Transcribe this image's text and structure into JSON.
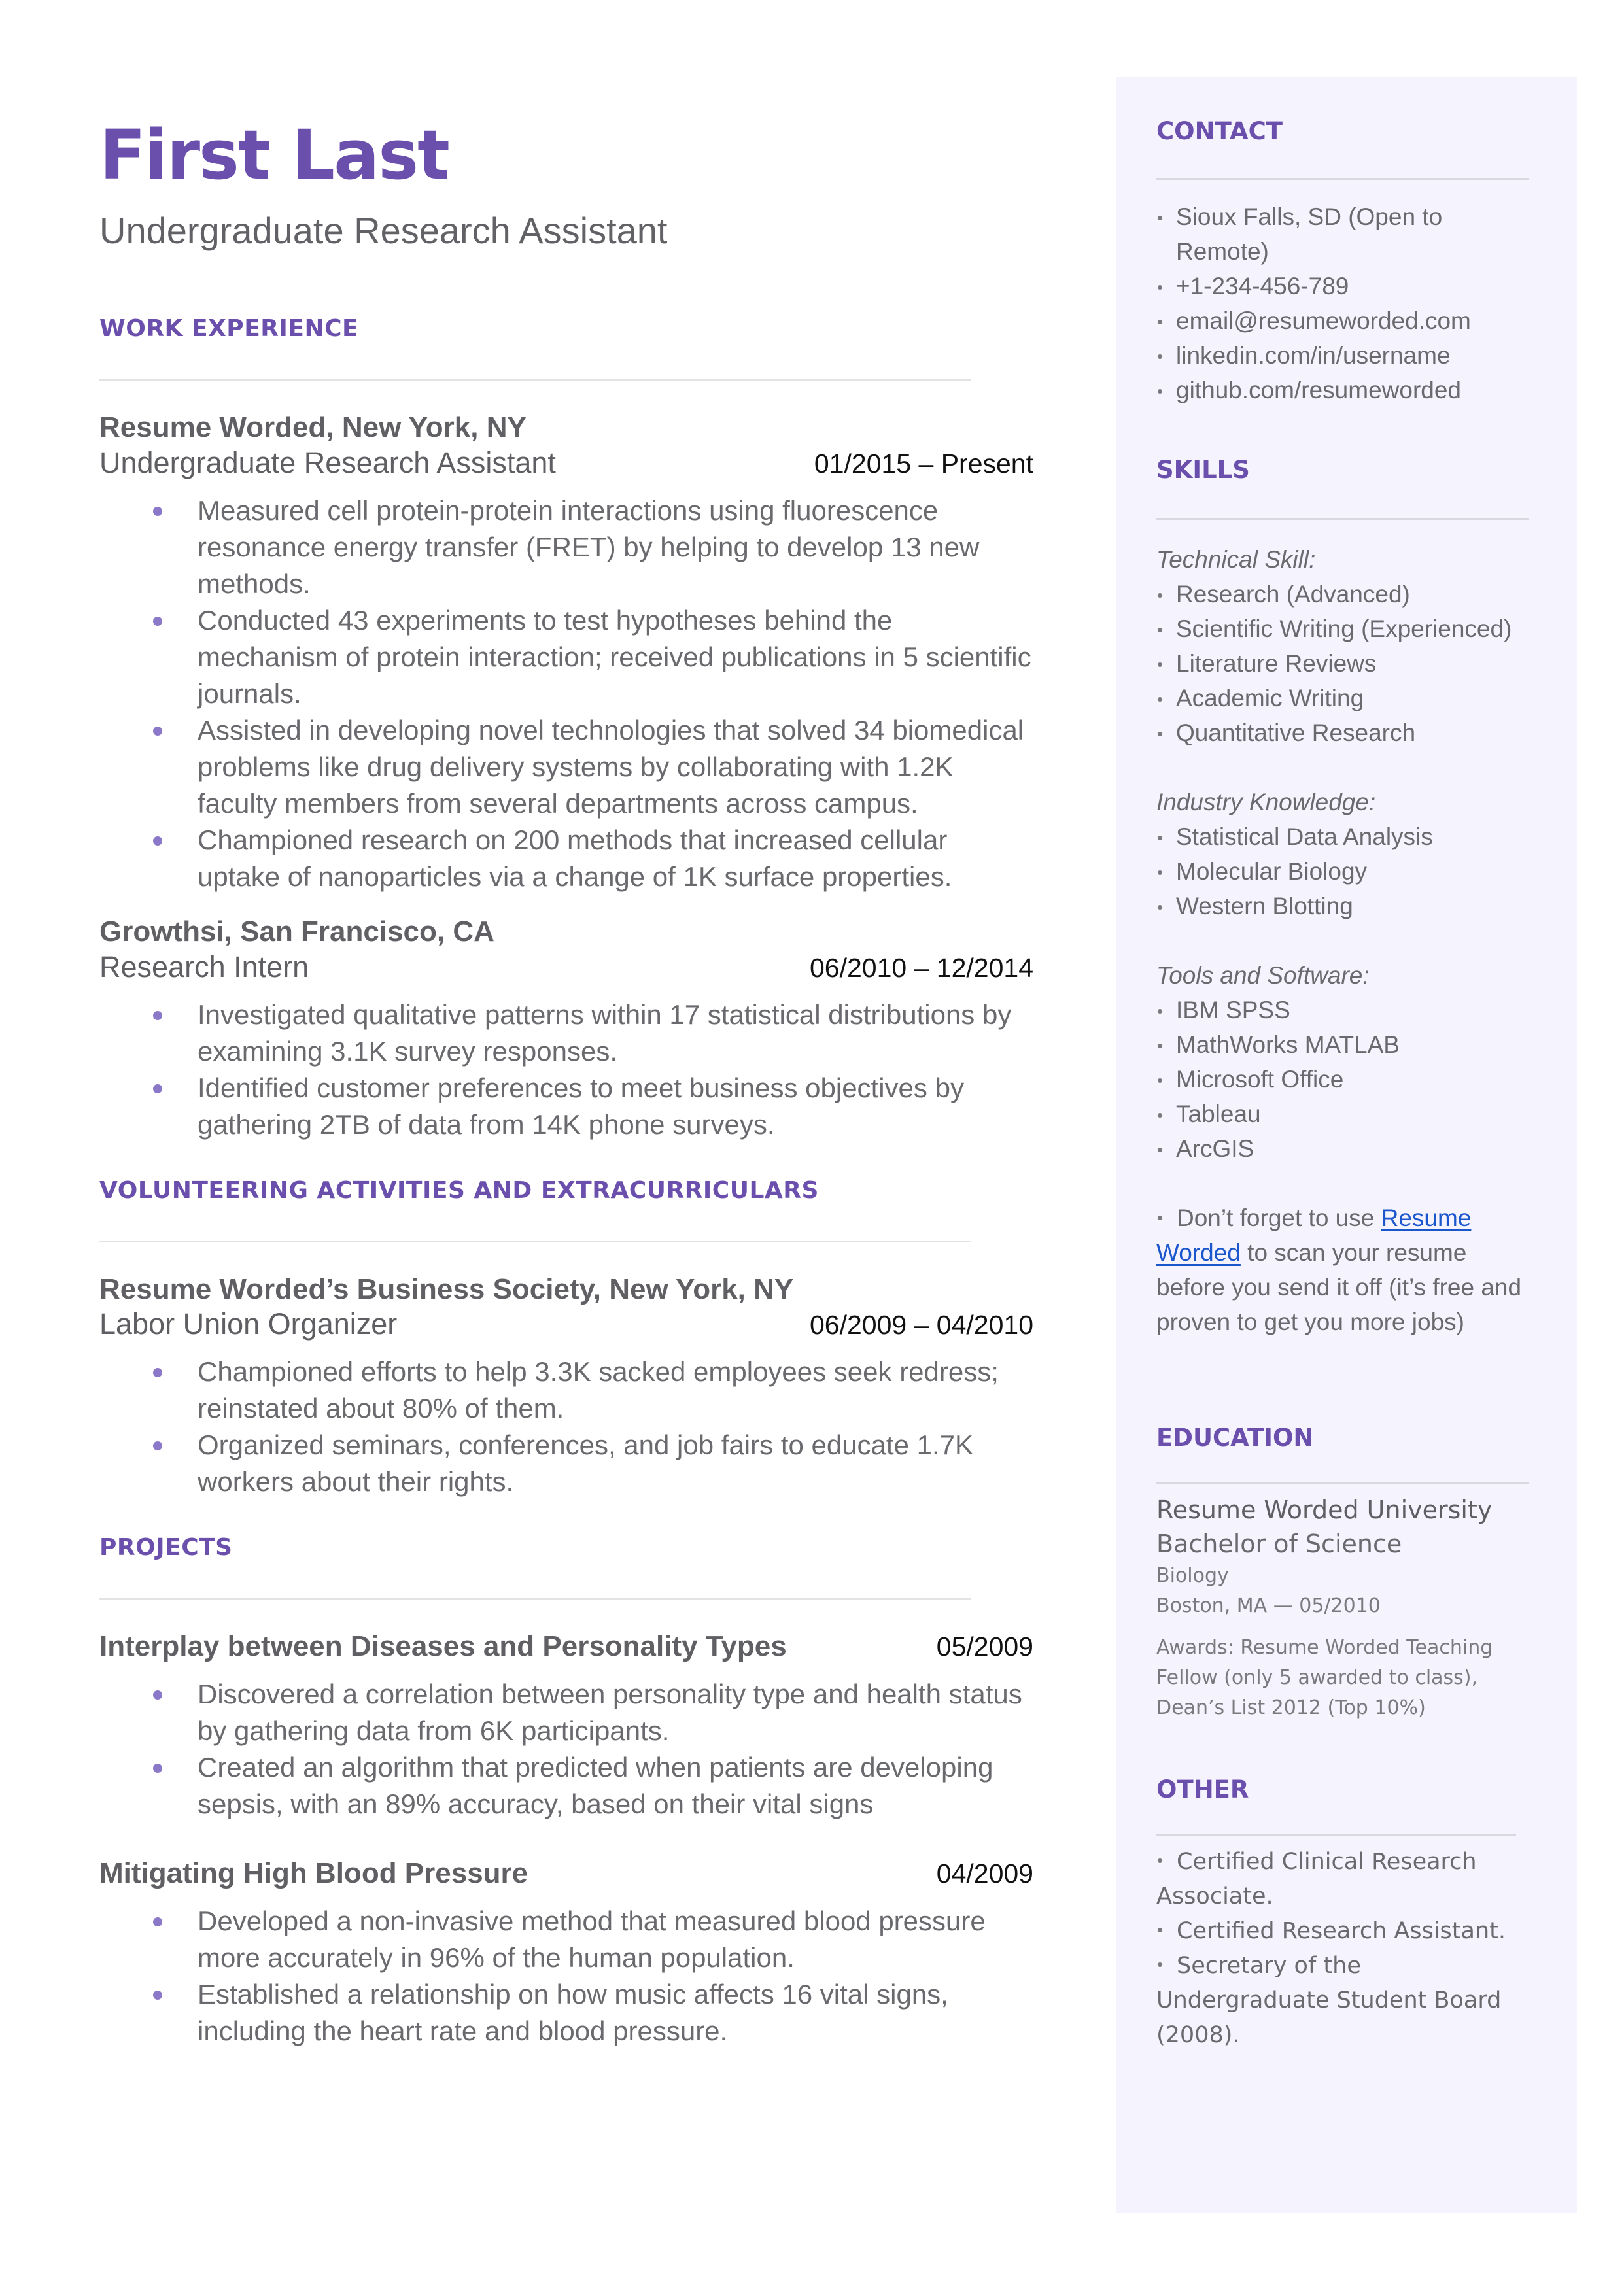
{
  "header": {
    "name": "First Last",
    "headline": "Undergraduate Research Assistant"
  },
  "colors": {
    "accent": "#6a4fad",
    "bullet": "#8c78c8",
    "sidebar_bg": "#f5f3fe",
    "link": "#1a56cc"
  },
  "work": {
    "title": "WORK EXPERIENCE",
    "entries": [
      {
        "org": "Resume Worded, New York, NY",
        "role": "Undergraduate Research Assistant",
        "date": "01/2015 – Present",
        "bullets": [
          "Measured cell protein-protein interactions using fluorescence resonance energy transfer (FRET) by helping to develop 13 new methods.",
          "Conducted 43 experiments to test hypotheses behind the mechanism of protein interaction; received publications in 5 scientific journals.",
          "Assisted in developing novel technologies that solved 34 biomedical problems like drug delivery systems by collaborating with 1.2K faculty members from several departments across campus.",
          "Championed research on 200 methods that increased cellular uptake of nanoparticles via a change of 1K surface properties."
        ]
      },
      {
        "org": "Growthsi, San Francisco, CA",
        "role": "Research Intern",
        "date": "06/2010 – 12/2014",
        "bullets": [
          "Investigated qualitative patterns within 17 statistical distributions by examining 3.1K survey responses.",
          "Identified customer preferences to meet business objectives by gathering 2TB of data from 14K phone surveys."
        ]
      }
    ]
  },
  "volunteering": {
    "title": "VOLUNTEERING ACTIVITIES AND EXTRACURRICULARS",
    "entries": [
      {
        "org": "Resume Worded’s Business Society, New York, NY",
        "role": "Labor Union Organizer",
        "date": "06/2009 – 04/2010",
        "bullets": [
          "Championed efforts to help 3.3K sacked employees seek redress; reinstated about 80% of them.",
          "Organized seminars, conferences, and job fairs to educate 1.7K workers about their rights."
        ]
      }
    ]
  },
  "projects": {
    "title": "PROJECTS",
    "entries": [
      {
        "name": "Interplay between Diseases and Personality Types",
        "date": "05/2009",
        "bullets": [
          "Discovered a correlation between personality type and health status by gathering data from 6K participants.",
          "Created an algorithm that predicted when patients are developing sepsis, with an 89% accuracy, based on their vital signs"
        ]
      },
      {
        "name": "Mitigating High Blood Pressure",
        "date": "04/2009",
        "bullets": [
          "Developed a non-invasive method that measured blood pressure more accurately in 96% of the human population.",
          "Established a relationship on how music affects 16 vital signs, including the heart rate and blood pressure."
        ]
      }
    ]
  },
  "sidebar": {
    "contact": {
      "title": "CONTACT",
      "items": [
        " Sioux Falls, SD (Open to Remote)",
        "+1-234-456-789",
        "email@resumeworded.com",
        "linkedin.com/in/username",
        "github.com/resumeworded"
      ]
    },
    "skills": {
      "title": "SKILLS",
      "groups": [
        {
          "label": "Technical Skill:",
          "items": [
            "Research (Advanced)",
            "Scientific Writing (Experienced)",
            "Literature Reviews",
            "Academic Writing",
            "Quantitative Research"
          ]
        },
        {
          "label": "Industry Knowledge:",
          "items": [
            "Statistical Data Analysis",
            "Molecular Biology",
            "Western Blotting"
          ]
        },
        {
          "label": "Tools and Software:",
          "items": [
            "IBM SPSS",
            "MathWorks MATLAB",
            "Microsoft Office",
            "Tableau",
            "ArcGIS"
          ]
        }
      ],
      "note": {
        "before": "Don’t forget to use ",
        "link": "Resume Worded",
        "after": " to scan your resume before you send it off (it’s free and proven to get you more jobs)"
      }
    },
    "education": {
      "title": "EDUCATION",
      "school": "Resume Worded University",
      "degree": "Bachelor of Science",
      "field": "Biology",
      "location_date": "Boston, MA — 05/2010",
      "awards": "Awards: Resume Worded Teaching Fellow (only 5 awarded to class), Dean’s List 2012 (Top 10%)"
    },
    "other": {
      "title": "OTHER",
      "items": [
        "Certified Clinical Research Associate.",
        "Certified Research Assistant.",
        "Secretary of the Undergraduate Student Board (2008)."
      ]
    }
  }
}
